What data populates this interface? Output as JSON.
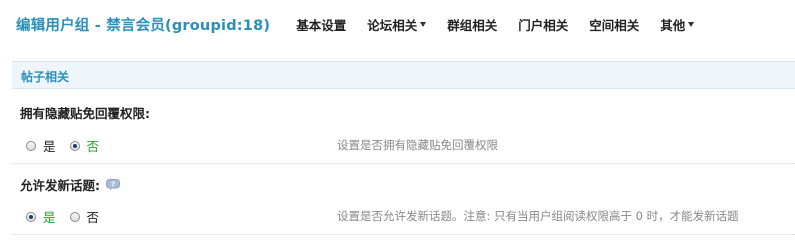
{
  "header": {
    "title": "编辑用户组 - 禁言会员(groupid:18)",
    "nav": [
      {
        "label": "基本设置",
        "dropdown": false
      },
      {
        "label": "论坛相关",
        "dropdown": true
      },
      {
        "label": "群组相关",
        "dropdown": false
      },
      {
        "label": "门户相关",
        "dropdown": false
      },
      {
        "label": "空间相关",
        "dropdown": false
      },
      {
        "label": "其他",
        "dropdown": true
      }
    ]
  },
  "section": {
    "title": "帖子相关"
  },
  "settings": [
    {
      "label": "拥有隐藏贴免回覆权限:",
      "has_help": false,
      "options": [
        {
          "label": "是",
          "checked": false
        },
        {
          "label": "否",
          "checked": true
        }
      ],
      "description": "设置是否拥有隐藏贴免回覆权限"
    },
    {
      "label": "允许发新话题:",
      "has_help": true,
      "help_icon": "help-bubble-icon",
      "options": [
        {
          "label": "是",
          "checked": true
        },
        {
          "label": "否",
          "checked": false
        }
      ],
      "description": "设置是否允许发新话题。注意: 只有当用户组阅读权限高于 0 时，才能发新话题"
    }
  ],
  "colors": {
    "title": "#2b8fba",
    "section_bg": "#eef5fb",
    "selected_option": "#2aa22a",
    "description": "#888888"
  }
}
